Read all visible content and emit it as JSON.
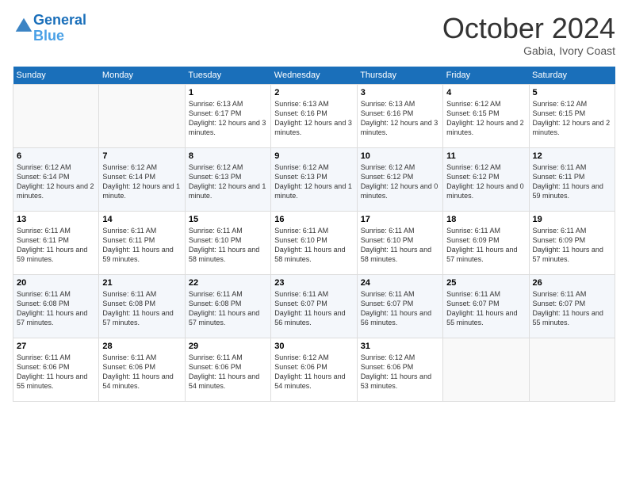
{
  "header": {
    "logo_line1": "General",
    "logo_line2": "Blue",
    "month_title": "October 2024",
    "location": "Gabia, Ivory Coast"
  },
  "weekdays": [
    "Sunday",
    "Monday",
    "Tuesday",
    "Wednesday",
    "Thursday",
    "Friday",
    "Saturday"
  ],
  "weeks": [
    [
      {
        "day": "",
        "info": ""
      },
      {
        "day": "",
        "info": ""
      },
      {
        "day": "1",
        "info": "Sunrise: 6:13 AM\nSunset: 6:17 PM\nDaylight: 12 hours and 3 minutes."
      },
      {
        "day": "2",
        "info": "Sunrise: 6:13 AM\nSunset: 6:16 PM\nDaylight: 12 hours and 3 minutes."
      },
      {
        "day": "3",
        "info": "Sunrise: 6:13 AM\nSunset: 6:16 PM\nDaylight: 12 hours and 3 minutes."
      },
      {
        "day": "4",
        "info": "Sunrise: 6:12 AM\nSunset: 6:15 PM\nDaylight: 12 hours and 2 minutes."
      },
      {
        "day": "5",
        "info": "Sunrise: 6:12 AM\nSunset: 6:15 PM\nDaylight: 12 hours and 2 minutes."
      }
    ],
    [
      {
        "day": "6",
        "info": "Sunrise: 6:12 AM\nSunset: 6:14 PM\nDaylight: 12 hours and 2 minutes."
      },
      {
        "day": "7",
        "info": "Sunrise: 6:12 AM\nSunset: 6:14 PM\nDaylight: 12 hours and 1 minute."
      },
      {
        "day": "8",
        "info": "Sunrise: 6:12 AM\nSunset: 6:13 PM\nDaylight: 12 hours and 1 minute."
      },
      {
        "day": "9",
        "info": "Sunrise: 6:12 AM\nSunset: 6:13 PM\nDaylight: 12 hours and 1 minute."
      },
      {
        "day": "10",
        "info": "Sunrise: 6:12 AM\nSunset: 6:12 PM\nDaylight: 12 hours and 0 minutes."
      },
      {
        "day": "11",
        "info": "Sunrise: 6:12 AM\nSunset: 6:12 PM\nDaylight: 12 hours and 0 minutes."
      },
      {
        "day": "12",
        "info": "Sunrise: 6:11 AM\nSunset: 6:11 PM\nDaylight: 11 hours and 59 minutes."
      }
    ],
    [
      {
        "day": "13",
        "info": "Sunrise: 6:11 AM\nSunset: 6:11 PM\nDaylight: 11 hours and 59 minutes."
      },
      {
        "day": "14",
        "info": "Sunrise: 6:11 AM\nSunset: 6:11 PM\nDaylight: 11 hours and 59 minutes."
      },
      {
        "day": "15",
        "info": "Sunrise: 6:11 AM\nSunset: 6:10 PM\nDaylight: 11 hours and 58 minutes."
      },
      {
        "day": "16",
        "info": "Sunrise: 6:11 AM\nSunset: 6:10 PM\nDaylight: 11 hours and 58 minutes."
      },
      {
        "day": "17",
        "info": "Sunrise: 6:11 AM\nSunset: 6:10 PM\nDaylight: 11 hours and 58 minutes."
      },
      {
        "day": "18",
        "info": "Sunrise: 6:11 AM\nSunset: 6:09 PM\nDaylight: 11 hours and 57 minutes."
      },
      {
        "day": "19",
        "info": "Sunrise: 6:11 AM\nSunset: 6:09 PM\nDaylight: 11 hours and 57 minutes."
      }
    ],
    [
      {
        "day": "20",
        "info": "Sunrise: 6:11 AM\nSunset: 6:08 PM\nDaylight: 11 hours and 57 minutes."
      },
      {
        "day": "21",
        "info": "Sunrise: 6:11 AM\nSunset: 6:08 PM\nDaylight: 11 hours and 57 minutes."
      },
      {
        "day": "22",
        "info": "Sunrise: 6:11 AM\nSunset: 6:08 PM\nDaylight: 11 hours and 57 minutes."
      },
      {
        "day": "23",
        "info": "Sunrise: 6:11 AM\nSunset: 6:07 PM\nDaylight: 11 hours and 56 minutes."
      },
      {
        "day": "24",
        "info": "Sunrise: 6:11 AM\nSunset: 6:07 PM\nDaylight: 11 hours and 56 minutes."
      },
      {
        "day": "25",
        "info": "Sunrise: 6:11 AM\nSunset: 6:07 PM\nDaylight: 11 hours and 55 minutes."
      },
      {
        "day": "26",
        "info": "Sunrise: 6:11 AM\nSunset: 6:07 PM\nDaylight: 11 hours and 55 minutes."
      }
    ],
    [
      {
        "day": "27",
        "info": "Sunrise: 6:11 AM\nSunset: 6:06 PM\nDaylight: 11 hours and 55 minutes."
      },
      {
        "day": "28",
        "info": "Sunrise: 6:11 AM\nSunset: 6:06 PM\nDaylight: 11 hours and 54 minutes."
      },
      {
        "day": "29",
        "info": "Sunrise: 6:11 AM\nSunset: 6:06 PM\nDaylight: 11 hours and 54 minutes."
      },
      {
        "day": "30",
        "info": "Sunrise: 6:12 AM\nSunset: 6:06 PM\nDaylight: 11 hours and 54 minutes."
      },
      {
        "day": "31",
        "info": "Sunrise: 6:12 AM\nSunset: 6:06 PM\nDaylight: 11 hours and 53 minutes."
      },
      {
        "day": "",
        "info": ""
      },
      {
        "day": "",
        "info": ""
      }
    ]
  ]
}
